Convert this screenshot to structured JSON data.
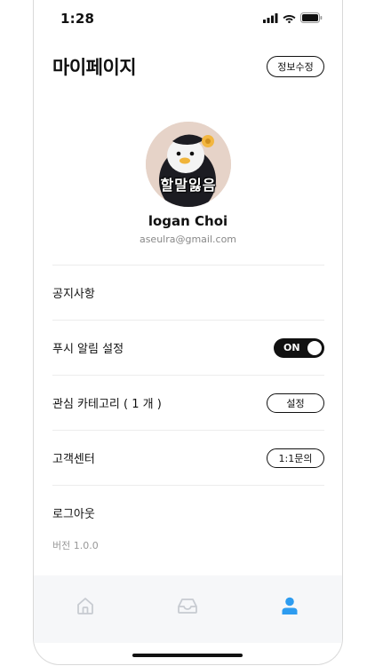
{
  "status_bar": {
    "time": "1:28"
  },
  "header": {
    "title": "마이페이지",
    "edit_label": "정보수정"
  },
  "profile": {
    "avatar_caption": "할말잃음",
    "name": "logan Choi",
    "email": "aseulra@gmail.com"
  },
  "menu": {
    "notice": "공지사항",
    "push_label": "푸시 알림 설정",
    "push_state": "ON",
    "category_label": "관심 카테고리 ( 1 개 )",
    "category_button": "설정",
    "support_label": "고객센터",
    "support_button": "1:1문의",
    "logout": "로그아웃"
  },
  "version": "버전 1.0.0",
  "tabbar": {
    "items": [
      {
        "icon": "home-icon",
        "active": false
      },
      {
        "icon": "inbox-icon",
        "active": false
      },
      {
        "icon": "person-icon",
        "active": true
      }
    ],
    "active_color": "#2d9cf0",
    "inactive_color": "#c7cbd1"
  }
}
